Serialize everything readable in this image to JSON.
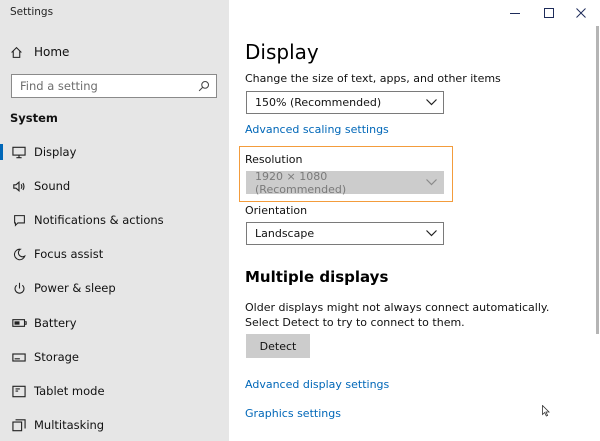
{
  "window": {
    "title": "Settings",
    "controls": [
      "minimize",
      "maximize",
      "close"
    ]
  },
  "sidebar": {
    "home_label": "Home",
    "search_placeholder": "Find a setting",
    "section_heading": "System",
    "items": [
      {
        "label": "Display",
        "icon": "monitor-icon",
        "active": true
      },
      {
        "label": "Sound",
        "icon": "speaker-icon"
      },
      {
        "label": "Notifications & actions",
        "icon": "notification-icon"
      },
      {
        "label": "Focus assist",
        "icon": "moon-icon"
      },
      {
        "label": "Power & sleep",
        "icon": "power-icon"
      },
      {
        "label": "Battery",
        "icon": "battery-icon"
      },
      {
        "label": "Storage",
        "icon": "storage-icon"
      },
      {
        "label": "Tablet mode",
        "icon": "tablet-icon"
      },
      {
        "label": "Multitasking",
        "icon": "multitasking-icon"
      }
    ]
  },
  "main": {
    "title": "Display",
    "scale_label": "Change the size of text, apps, and other items",
    "scale_value": "150% (Recommended)",
    "advanced_scaling_link": "Advanced scaling settings",
    "resolution_label": "Resolution",
    "resolution_value": "1920 × 1080 (Recommended)",
    "orientation_label": "Orientation",
    "orientation_value": "Landscape",
    "multiple_displays_title": "Multiple displays",
    "multiple_displays_text": "Older displays might not always connect automatically. Select Detect to try to connect to them.",
    "detect_button": "Detect",
    "advanced_display_link": "Advanced display settings",
    "graphics_link": "Graphics settings"
  },
  "colors": {
    "accent": "#0067b8",
    "highlight_border": "#f39c3c",
    "sidebar_bg": "#e6e6e6"
  }
}
